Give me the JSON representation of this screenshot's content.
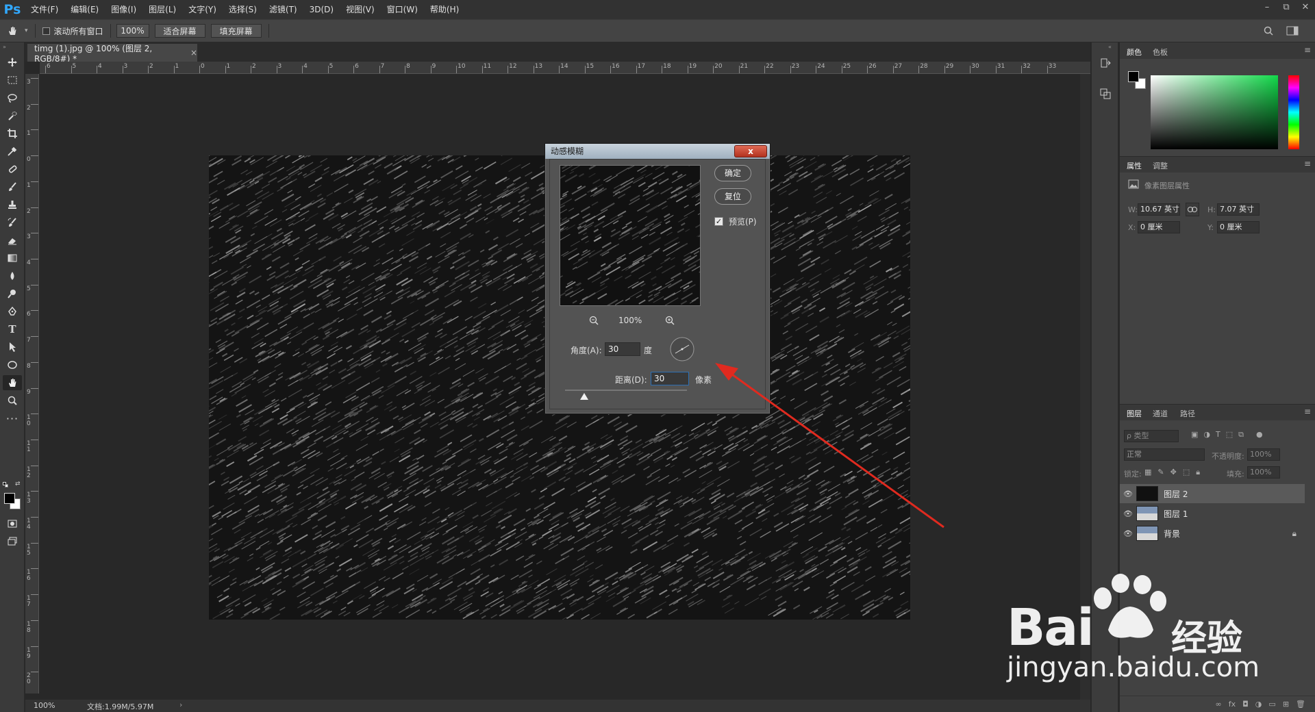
{
  "app": {
    "logo": "Ps"
  },
  "menubar": {
    "items": [
      "文件(F)",
      "编辑(E)",
      "图像(I)",
      "图层(L)",
      "文字(Y)",
      "选择(S)",
      "滤镜(T)",
      "3D(D)",
      "视图(V)",
      "窗口(W)",
      "帮助(H)"
    ],
    "window_controls": [
      "–",
      "⧉",
      "✕"
    ]
  },
  "options": {
    "scroll_all_label": "滚动所有窗口",
    "zoom_value": "100%",
    "fit_screen": "适合屏幕",
    "fill_screen": "填充屏幕"
  },
  "document": {
    "tab_title": "timg (1).jpg @ 100% (图层 2, RGB/8#) *",
    "tab_close": "×"
  },
  "rulers": {
    "h_labels": [
      "6",
      "5",
      "4",
      "3",
      "2",
      "1",
      "0",
      "1",
      "2",
      "3",
      "4",
      "5",
      "6",
      "7",
      "8",
      "9",
      "10",
      "11",
      "12",
      "13",
      "14",
      "15",
      "16",
      "17",
      "18",
      "19",
      "20",
      "21",
      "22",
      "23",
      "24",
      "25",
      "26",
      "27",
      "28",
      "29",
      "30",
      "31",
      "32",
      "33"
    ],
    "v_labels": [
      "3",
      "2",
      "1",
      "0",
      "1",
      "2",
      "3",
      "4",
      "5",
      "6",
      "7",
      "8",
      "9",
      "1 0",
      "1 1",
      "1 2",
      "1 3",
      "1 4",
      "1 5",
      "1 6",
      "1 7",
      "1 8",
      "1 9",
      "2 0"
    ]
  },
  "status": {
    "zoom": "100%",
    "doc_size": "文档:1.99M/5.97M",
    "arrow": "›"
  },
  "dialog": {
    "title": "动感模糊",
    "close": "x",
    "ok": "确定",
    "reset": "复位",
    "preview_label": "预览(P)",
    "preview_checked": true,
    "zoom_value": "100%",
    "angle_label": "角度(A):",
    "angle_value": "30",
    "angle_unit": "度",
    "distance_label": "距离(D):",
    "distance_value": "30",
    "distance_unit": "像素"
  },
  "panels": {
    "color": {
      "tabs": [
        "颜色",
        "色板"
      ]
    },
    "properties": {
      "tabs": [
        "属性",
        "调整"
      ],
      "title": "像素图层属性",
      "w_label": "W:",
      "w_value": "10.67 英寸",
      "h_label": "H:",
      "h_value": "7.07 英寸",
      "x_label": "X:",
      "x_value": "0 厘米",
      "y_label": "Y:",
      "y_value": "0 厘米"
    },
    "layers": {
      "tabs": [
        "图层",
        "通道",
        "路径"
      ],
      "filter_placeholder": "ρ 类型",
      "blend_mode": "正常",
      "opacity_label": "不透明度:",
      "opacity_value": "100%",
      "lock_label": "锁定:",
      "fill_label": "填充:",
      "fill_value": "100%",
      "items": [
        {
          "name": "图层 2"
        },
        {
          "name": "图层 1"
        },
        {
          "name": "背景"
        }
      ]
    }
  },
  "watermark": {
    "brand": "Bai",
    "brand_cn": "经验",
    "url": "jingyan.baidu.com"
  },
  "colors": {
    "accent": "#31a8ff",
    "arrow": "#e02a1f",
    "selected_layer": "#5a5a5a"
  }
}
